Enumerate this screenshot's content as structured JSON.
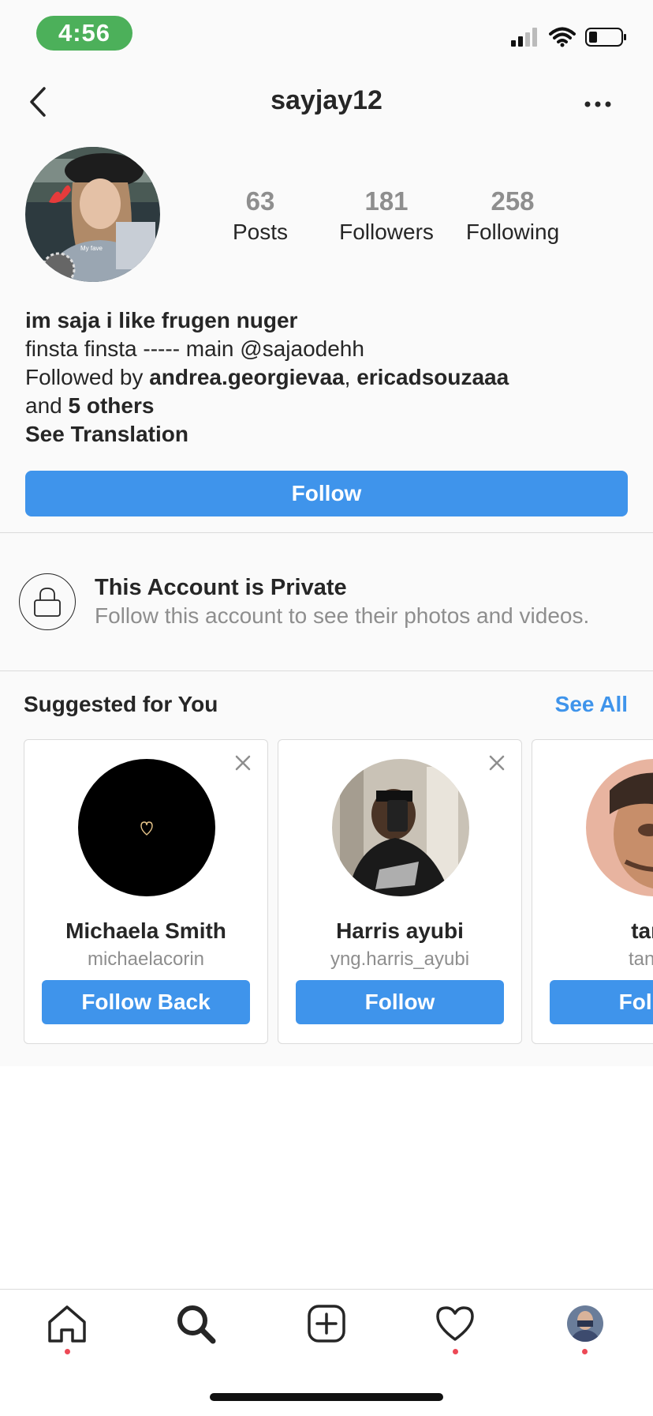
{
  "status_bar": {
    "time": "4:56"
  },
  "header": {
    "username": "sayjay12"
  },
  "profile": {
    "avatar_caption": "My fave",
    "stats": [
      {
        "value": "63",
        "label": "Posts"
      },
      {
        "value": "181",
        "label": "Followers"
      },
      {
        "value": "258",
        "label": "Following"
      }
    ],
    "bio_name": "im saja i like frugen nuger",
    "bio_text": "finsta finsta ----- main @sajaodehh",
    "followed_by_prefix": "Followed by ",
    "followed_by_user1": "andrea.georgievaa",
    "followed_by_sep": ", ",
    "followed_by_user2": "ericadsouzaaa",
    "followed_by_and": "and ",
    "followed_by_others": "5 others",
    "see_translation": "See Translation",
    "follow_button": "Follow"
  },
  "private_notice": {
    "title": "This Account is Private",
    "subtitle": "Follow this account to see their photos and videos."
  },
  "suggested": {
    "title": "Suggested for You",
    "see_all": "See All",
    "cards": [
      {
        "name": "Michaela Smith",
        "handle": "michaelacorin",
        "button": "Follow Back"
      },
      {
        "name": "Harris ayubi",
        "handle": "yng.harris_ayubi",
        "button": "Follow"
      },
      {
        "name": "tana",
        "handle": "tanayj",
        "button": "Follow"
      }
    ]
  },
  "tab_bar": {
    "tabs": [
      "home",
      "search",
      "new-post",
      "activity",
      "profile"
    ],
    "notification_dots": [
      "home",
      "activity",
      "profile"
    ]
  },
  "colors": {
    "accent_blue": "#3f94eb",
    "status_time_green": "#4cb05a",
    "notification_red": "#ed4956",
    "muted_text": "#8e8e8e"
  }
}
